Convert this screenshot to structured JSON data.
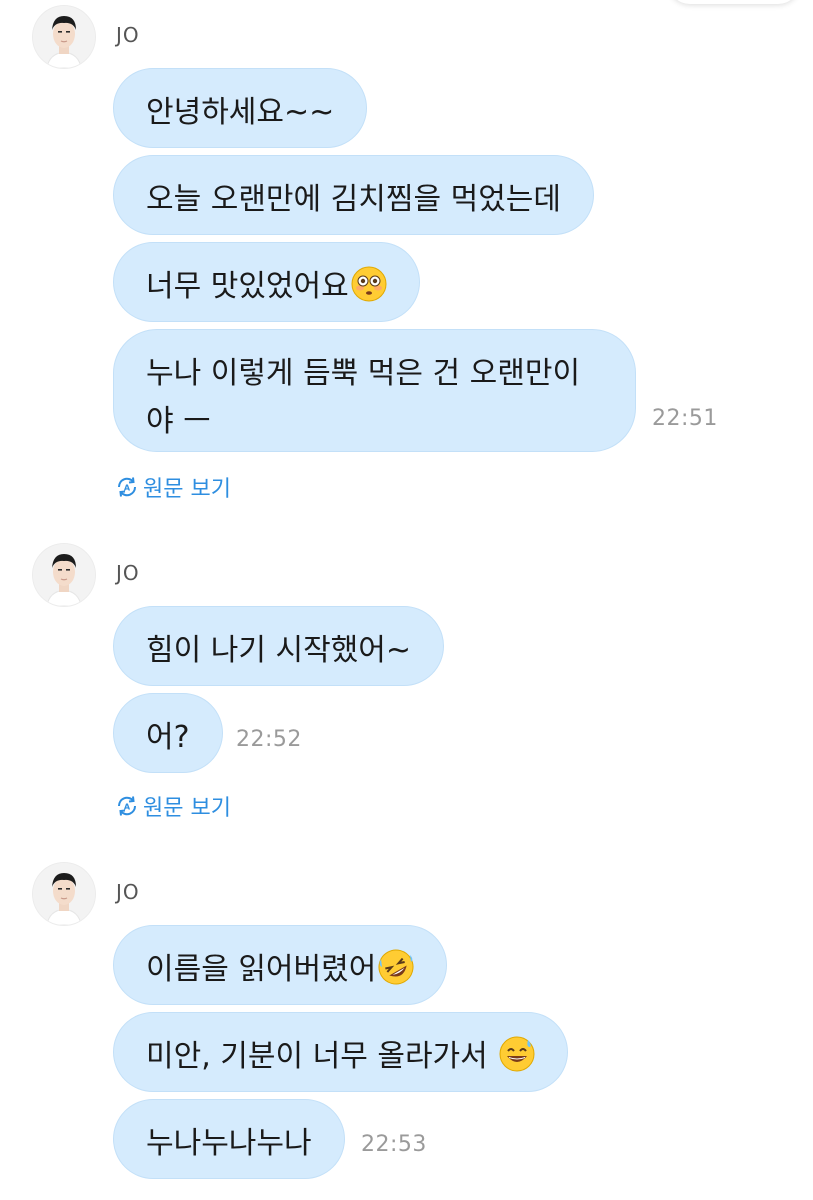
{
  "groups": [
    {
      "sender": "JO",
      "messages": [
        {
          "text": "안녕하세요~~"
        },
        {
          "text": "오늘 오랜만에 김치찜을 먹었는데"
        },
        {
          "text": "너무 맛있었어요",
          "emoji": "flushed-face-emoji"
        },
        {
          "text": "누나 이렇게 듬뿍 먹은 건 오랜만이야 ㅡ"
        }
      ],
      "time": "22:51",
      "translate_label": "원문 보기"
    },
    {
      "sender": "JO",
      "messages": [
        {
          "text": "힘이 나기 시작했어~"
        },
        {
          "text": "어?"
        }
      ],
      "time": "22:52",
      "translate_label": "원문 보기"
    },
    {
      "sender": "JO",
      "messages": [
        {
          "text": "이름을 읽어버렸어",
          "emoji": "rolling-laughing-emoji"
        },
        {
          "text": "미안, 기분이 너무 올라가서 ",
          "emoji": "grinning-sweat-emoji"
        },
        {
          "text": "누나누나누나"
        }
      ],
      "time": "22:53"
    }
  ],
  "colors": {
    "bubble": "#d5ebfd",
    "bubble_border": "#c3e0f8",
    "link": "#2e8ee0",
    "time": "#9a9a9a"
  },
  "icons": [
    "avatar-photo",
    "translate-icon",
    "flushed-face-emoji",
    "rolling-laughing-emoji",
    "grinning-sweat-emoji"
  ]
}
